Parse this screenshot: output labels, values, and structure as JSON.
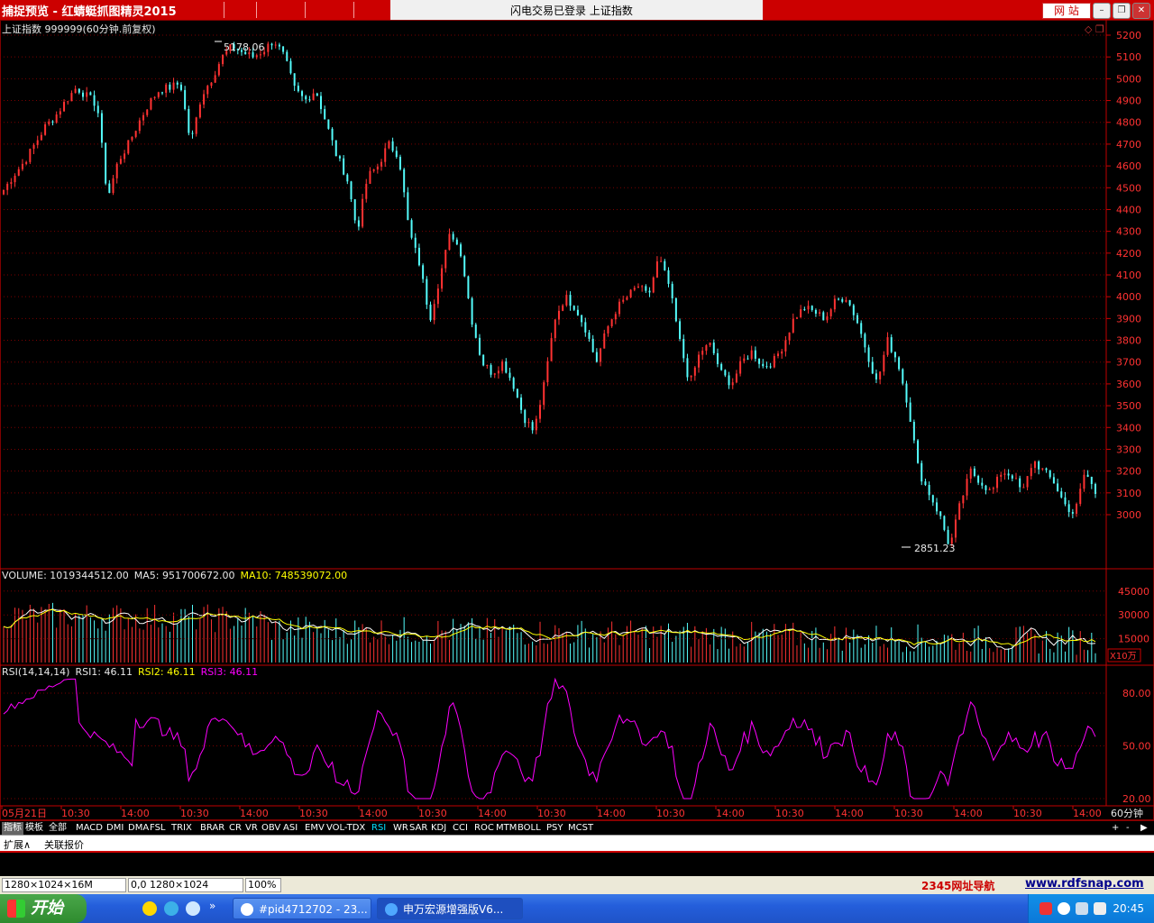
{
  "window": {
    "title": "捕捉预览 - 红蜻蜓抓图精灵2015",
    "center_text": "闪电交易已登录   上证指数",
    "web_button": "网  站",
    "min_label": "–",
    "restore_label": "❐",
    "close_label": "✕"
  },
  "main_chart": {
    "title": "上证指数 999999(60分钟.前复权)",
    "high_label": "5178.06",
    "low_label": "2851.23",
    "y_ticks": [
      "5200",
      "5100",
      "5000",
      "4900",
      "4800",
      "4700",
      "4600",
      "4500",
      "4400",
      "4300",
      "4200",
      "4100",
      "4000",
      "3900",
      "3800",
      "3700",
      "3600",
      "3500",
      "3400",
      "3300",
      "3200",
      "3100",
      "3000"
    ],
    "y_values": [
      5200,
      5100,
      5000,
      4900,
      4800,
      4700,
      4600,
      4500,
      4400,
      4300,
      4200,
      4100,
      4000,
      3900,
      3800,
      3700,
      3600,
      3500,
      3400,
      3300,
      3200,
      3100,
      3000
    ],
    "up_color": "#ff3232",
    "down_color": "#54fcfc"
  },
  "chart_data": {
    "type": "candlestick",
    "series_close": [
      4490,
      4560,
      4620,
      4700,
      4780,
      4830,
      4900,
      4960,
      4920,
      4880,
      4450,
      4620,
      4700,
      4800,
      4890,
      4950,
      4960,
      4980,
      4700,
      4920,
      5000,
      5100,
      5150,
      5120,
      5100,
      5130,
      5178.06,
      5100,
      4950,
      4900,
      4950,
      4800,
      4650,
      4550,
      4300,
      4550,
      4600,
      4700,
      4650,
      4300,
      4150,
      3900,
      4100,
      4300,
      4200,
      3900,
      3700,
      3650,
      3700,
      3600,
      3450,
      3380,
      3600,
      3900,
      4000,
      3950,
      3850,
      3700,
      3850,
      3950,
      4000,
      4050,
      4000,
      4180,
      4050,
      3800,
      3600,
      3750,
      3780,
      3650,
      3600,
      3700,
      3750,
      3680,
      3700,
      3780,
      3900,
      3950,
      3930,
      3900,
      3980,
      4000,
      3900,
      3750,
      3600,
      3800,
      3700,
      3500,
      3200,
      3100,
      3000,
      2851.23,
      3050,
      3200,
      3150,
      3100,
      3200,
      3180,
      3100,
      3250,
      3200,
      3150,
      3050,
      3000,
      3200,
      3100
    ]
  },
  "volume": {
    "label_volume": "VOLUME: 1019344512.00",
    "label_ma5": "MA5: 951700672.00",
    "label_ma10": "MA10: 748539072.00",
    "y_ticks": [
      "45000",
      "30000",
      "15000"
    ],
    "unit_box": "X10万"
  },
  "rsi": {
    "label_name": "RSI(14,14,14)",
    "label_rsi1": "RSI1: 46.11",
    "label_rsi2": "RSI2: 46.11",
    "label_rsi3": "RSI3: 46.11",
    "y_ticks": [
      "80.00",
      "50.00",
      "20.00"
    ],
    "line_color": "#ff00ff"
  },
  "time_axis": {
    "labels": [
      "05月21日",
      "10:30",
      "14:00",
      "10:30",
      "14:00",
      "10:30",
      "14:00",
      "10:30",
      "14:00",
      "10:30",
      "14:00",
      "10:30",
      "14:00",
      "10:30",
      "14:00",
      "10:30",
      "14:00",
      "10:30",
      "14:00"
    ],
    "period": "60分钟"
  },
  "indicator_tabs": [
    "指标",
    "模板",
    "全部",
    "MACD",
    "DMI",
    "DMA",
    "FSL",
    "TRIX",
    "BRAR",
    "CR",
    "VR",
    "OBV",
    "ASI",
    "EMV",
    "VOL-TDX",
    "RSI",
    "WR",
    "SAR",
    "KDJ",
    "CCI",
    "ROC",
    "MTM",
    "BOLL",
    "PSY",
    "MCST"
  ],
  "active_tab": "RSI",
  "tab_plus": "+",
  "tab_minus": "-",
  "tab_arrow": "▶",
  "sub_tabs": [
    "扩展∧",
    "关联报价"
  ],
  "statusbar": {
    "size": "1280×1024×16M",
    "coords": "0,0 1280×1024",
    "zoom": "100%",
    "nav_link": "2345网址导航",
    "snap_link": "www.rdfsnap.com"
  },
  "taskbar": {
    "start_label": "开始",
    "tasks": [
      "#pid4712702 - 23...",
      "申万宏源增强版V6..."
    ],
    "clock": "20:45",
    "more": "»"
  }
}
